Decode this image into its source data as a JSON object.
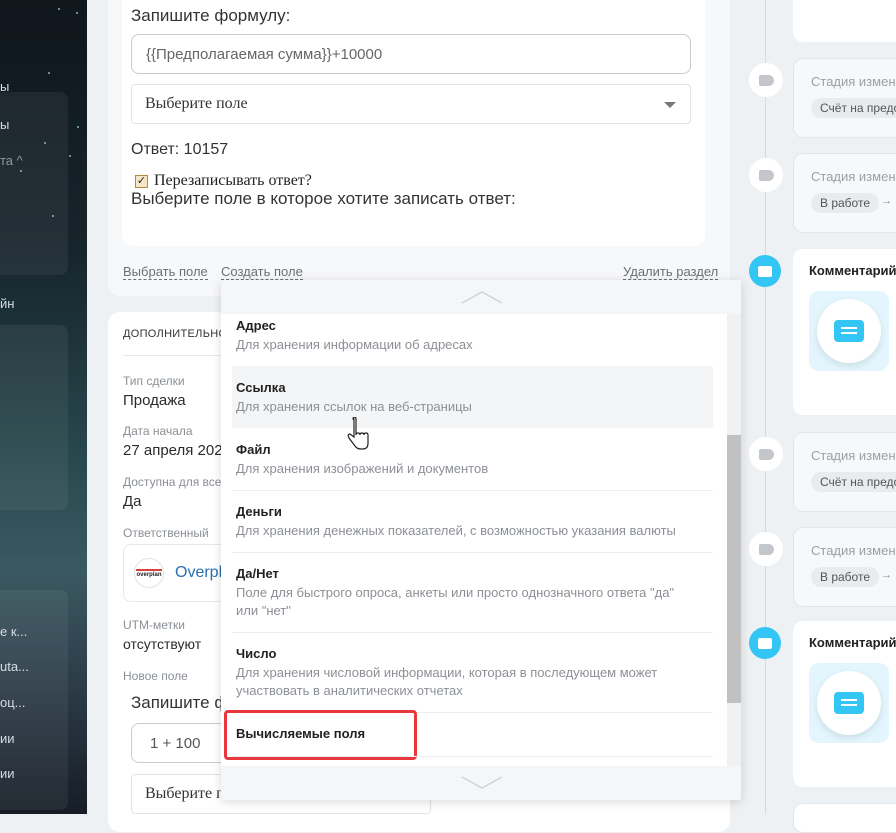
{
  "sidebar": {
    "items": [
      "ы",
      "ы",
      "та ^",
      "йн",
      "е к...",
      "uta...",
      "оц...",
      "ии",
      "ии"
    ]
  },
  "formula_card": {
    "formula_label": "Запишите формулу:",
    "formula_value": "{{Предполагаемая сумма}}+10000",
    "select_placeholder": "Выберите поле",
    "answer": "Ответ: 10157",
    "overwrite_label": "Перезаписывать ответ?",
    "overwrite_checked": true,
    "target_label": "Выберите поле в которое хотите записать ответ:",
    "links": {
      "choose": "Выбрать поле",
      "create": "Создать поле",
      "delete": "Удалить раздел"
    }
  },
  "details_card": {
    "title": "ДОПОЛНИТЕЛЬНО",
    "fields": [
      {
        "label": "Тип сделки",
        "value": "Продажа"
      },
      {
        "label": "Дата начала",
        "value": "27 апреля 202"
      },
      {
        "label": "Доступна для всех",
        "value": "Да"
      }
    ],
    "responsible_label": "Ответственный",
    "responsible_name": "Overpla",
    "responsible_logo": "overplan",
    "utm_label": "UTM-метки",
    "utm_value": "отсутствуют",
    "new_field_label": "Новое поле",
    "formula_label": "Запишите ф",
    "formula_value": "1 + 100",
    "select_placeholder": "Выберите п"
  },
  "dropdown": {
    "items": [
      {
        "title": "Адрес",
        "desc": "Для хранения информации об адресах"
      },
      {
        "title": "Ссылка",
        "desc": "Для хранения ссылок на веб-страницы"
      },
      {
        "title": "Файл",
        "desc": "Для хранения изображений и документов"
      },
      {
        "title": "Деньги",
        "desc": "Для хранения денежных показателей, с возможностью указания валюты"
      },
      {
        "title": "Да/Нет",
        "desc": "Поле для быстрого опроса, анкеты или просто однозначного ответа \"да\" или \"нет\""
      },
      {
        "title": "Число",
        "desc": "Для хранения числовой информации, которая в последующем может участвовать в аналитических отчетах"
      },
      {
        "title": "Вычисляемые поля",
        "desc": ""
      }
    ],
    "hovered_index": 1,
    "highlighted_index": 6,
    "highlight_color": "#e8383d",
    "scroll_fraction": 0.6
  },
  "timeline": {
    "stage1": {
      "title": "Стадия измен",
      "pill": "Счёт на предо"
    },
    "stage2": {
      "title": "Стадия измен",
      "pill": "В работе",
      "arrow": "→"
    },
    "comment1": {
      "title": "Комментарий"
    },
    "stage3": {
      "title": "Стадия измен",
      "pill": "Счёт на предо"
    },
    "stage4": {
      "title": "Стадия измен",
      "pill": "В работе",
      "arrow": "→"
    },
    "comment2": {
      "title": "Комментарий"
    },
    "accent": "#33c5f3"
  }
}
